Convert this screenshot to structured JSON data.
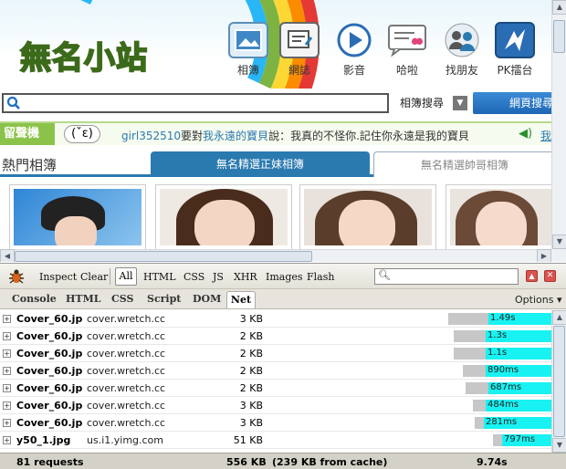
{
  "site": {
    "logo": "無名小站",
    "nav": [
      {
        "id": "album",
        "label": "相簿"
      },
      {
        "id": "blog",
        "label": "網誌"
      },
      {
        "id": "video",
        "label": "影音"
      },
      {
        "id": "chat",
        "label": "哈啦"
      },
      {
        "id": "friends",
        "label": "找朋友"
      },
      {
        "id": "pk",
        "label": "PK擂台"
      }
    ],
    "search": {
      "value": "",
      "category": "相簿搜尋",
      "button": "網頁搜尋"
    },
    "guestbook": {
      "title": "留聲機",
      "face": "(ˇε)",
      "user": "girl352510",
      "verb_to": "要對",
      "target": "我永遠的寶貝",
      "verb_say": "說：",
      "message": "我真的不怪你.記住你永遠是我的寶貝",
      "more": "我"
    },
    "albums": {
      "hot_title": "熱門相簿",
      "tabs": [
        "無名精選正妹相簿",
        "無名精選帥哥相簿"
      ]
    }
  },
  "firebug": {
    "toolbar": {
      "inspect": "Inspect",
      "clear": "Clear",
      "filters": [
        "All",
        "HTML",
        "CSS",
        "JS",
        "XHR",
        "Images",
        "Flash"
      ],
      "search_value": ""
    },
    "panels": [
      "Console",
      "HTML",
      "CSS",
      "Script",
      "DOM",
      "Net"
    ],
    "active_panel": "Net",
    "options": "Options ▾",
    "requests": [
      {
        "name": "Cover_60.jpg",
        "domain": "cover.wretch.cc",
        "size": "3 KB",
        "time": "1.49s"
      },
      {
        "name": "Cover_60.jpg",
        "domain": "cover.wretch.cc",
        "size": "2 KB",
        "time": "1.3s"
      },
      {
        "name": "Cover_60.jpg",
        "domain": "cover.wretch.cc",
        "size": "2 KB",
        "time": "1.1s"
      },
      {
        "name": "Cover_60.jpg",
        "domain": "cover.wretch.cc",
        "size": "2 KB",
        "time": "890ms"
      },
      {
        "name": "Cover_60.jpg",
        "domain": "cover.wretch.cc",
        "size": "2 KB",
        "time": "687ms"
      },
      {
        "name": "Cover_60.jpg",
        "domain": "cover.wretch.cc",
        "size": "3 KB",
        "time": "484ms"
      },
      {
        "name": "Cover_60.jpg",
        "domain": "cover.wretch.cc",
        "size": "3 KB",
        "time": "281ms"
      },
      {
        "name": "y50_1.jpg",
        "domain": "us.i1.yimg.com",
        "size": "51 KB",
        "time": "797ms"
      }
    ],
    "summary": {
      "requests": "81 requests",
      "total_size": "556 KB",
      "cache": "(239 KB from cache)",
      "total_time": "9.74s"
    }
  },
  "colors": {
    "accent_blue": "#2a7ab0",
    "green": "#8bc34a",
    "net_receive": "#18f2f2",
    "net_wait": "#c7c7c7"
  }
}
